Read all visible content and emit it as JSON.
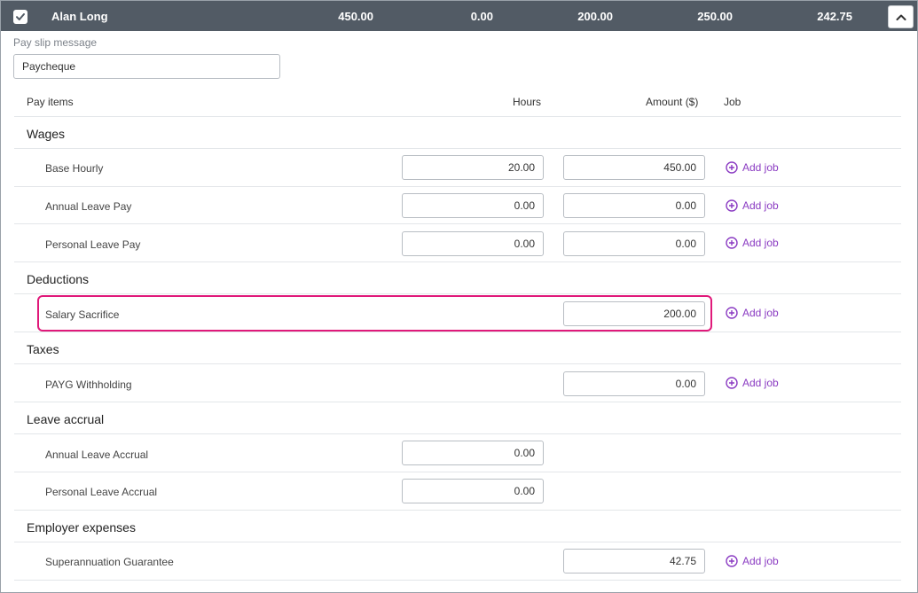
{
  "header": {
    "employee_name": "Alan Long",
    "values": [
      "450.00",
      "0.00",
      "200.00",
      "250.00",
      "242.75"
    ],
    "checked": true,
    "collapse_icon": "chevron-up-icon"
  },
  "message": {
    "label": "Pay slip message",
    "value": "Paycheque"
  },
  "columns": {
    "pay_items": "Pay items",
    "hours": "Hours",
    "amount": "Amount ($)",
    "job": "Job"
  },
  "add_job_label": "Add job",
  "sections": {
    "wages": {
      "title": "Wages",
      "items": [
        {
          "name": "Base Hourly",
          "hours": "20.00",
          "amount": "450.00"
        },
        {
          "name": "Annual Leave Pay",
          "hours": "0.00",
          "amount": "0.00"
        },
        {
          "name": "Personal Leave Pay",
          "hours": "0.00",
          "amount": "0.00"
        }
      ]
    },
    "deductions": {
      "title": "Deductions",
      "items": [
        {
          "name": "Salary Sacrifice",
          "amount": "200.00"
        }
      ]
    },
    "taxes": {
      "title": "Taxes",
      "items": [
        {
          "name": "PAYG Withholding",
          "amount": "0.00"
        }
      ]
    },
    "leave_accrual": {
      "title": "Leave accrual",
      "items": [
        {
          "name": "Annual Leave Accrual",
          "hours": "0.00"
        },
        {
          "name": "Personal Leave Accrual",
          "hours": "0.00"
        }
      ]
    },
    "employer_expenses": {
      "title": "Employer expenses",
      "items": [
        {
          "name": "Superannuation Guarantee",
          "amount": "42.75"
        }
      ]
    }
  },
  "colors": {
    "header_bg": "#525b65",
    "accent": "#8a3ac2",
    "highlight": "#e0197a"
  }
}
